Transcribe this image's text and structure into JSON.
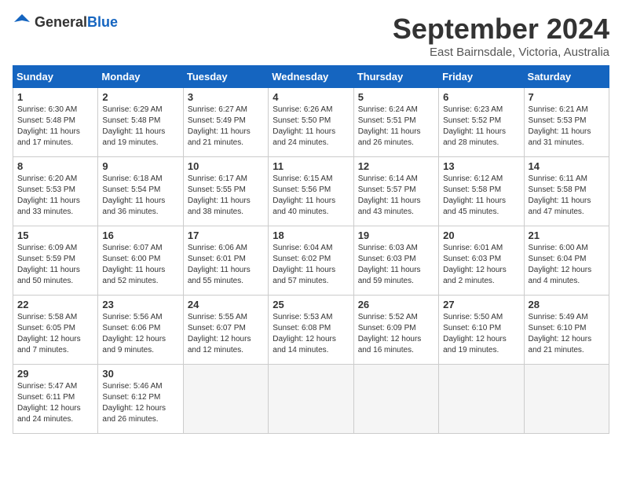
{
  "logo": {
    "general": "General",
    "blue": "Blue"
  },
  "title": "September 2024",
  "location": "East Bairnsdale, Victoria, Australia",
  "days_of_week": [
    "Sunday",
    "Monday",
    "Tuesday",
    "Wednesday",
    "Thursday",
    "Friday",
    "Saturday"
  ],
  "weeks": [
    [
      {
        "day": "1",
        "sunrise": "6:30 AM",
        "sunset": "5:48 PM",
        "daylight": "11 hours and 17 minutes."
      },
      {
        "day": "2",
        "sunrise": "6:29 AM",
        "sunset": "5:48 PM",
        "daylight": "11 hours and 19 minutes."
      },
      {
        "day": "3",
        "sunrise": "6:27 AM",
        "sunset": "5:49 PM",
        "daylight": "11 hours and 21 minutes."
      },
      {
        "day": "4",
        "sunrise": "6:26 AM",
        "sunset": "5:50 PM",
        "daylight": "11 hours and 24 minutes."
      },
      {
        "day": "5",
        "sunrise": "6:24 AM",
        "sunset": "5:51 PM",
        "daylight": "11 hours and 26 minutes."
      },
      {
        "day": "6",
        "sunrise": "6:23 AM",
        "sunset": "5:52 PM",
        "daylight": "11 hours and 28 minutes."
      },
      {
        "day": "7",
        "sunrise": "6:21 AM",
        "sunset": "5:53 PM",
        "daylight": "11 hours and 31 minutes."
      }
    ],
    [
      {
        "day": "8",
        "sunrise": "6:20 AM",
        "sunset": "5:53 PM",
        "daylight": "11 hours and 33 minutes."
      },
      {
        "day": "9",
        "sunrise": "6:18 AM",
        "sunset": "5:54 PM",
        "daylight": "11 hours and 36 minutes."
      },
      {
        "day": "10",
        "sunrise": "6:17 AM",
        "sunset": "5:55 PM",
        "daylight": "11 hours and 38 minutes."
      },
      {
        "day": "11",
        "sunrise": "6:15 AM",
        "sunset": "5:56 PM",
        "daylight": "11 hours and 40 minutes."
      },
      {
        "day": "12",
        "sunrise": "6:14 AM",
        "sunset": "5:57 PM",
        "daylight": "11 hours and 43 minutes."
      },
      {
        "day": "13",
        "sunrise": "6:12 AM",
        "sunset": "5:58 PM",
        "daylight": "11 hours and 45 minutes."
      },
      {
        "day": "14",
        "sunrise": "6:11 AM",
        "sunset": "5:58 PM",
        "daylight": "11 hours and 47 minutes."
      }
    ],
    [
      {
        "day": "15",
        "sunrise": "6:09 AM",
        "sunset": "5:59 PM",
        "daylight": "11 hours and 50 minutes."
      },
      {
        "day": "16",
        "sunrise": "6:07 AM",
        "sunset": "6:00 PM",
        "daylight": "11 hours and 52 minutes."
      },
      {
        "day": "17",
        "sunrise": "6:06 AM",
        "sunset": "6:01 PM",
        "daylight": "11 hours and 55 minutes."
      },
      {
        "day": "18",
        "sunrise": "6:04 AM",
        "sunset": "6:02 PM",
        "daylight": "11 hours and 57 minutes."
      },
      {
        "day": "19",
        "sunrise": "6:03 AM",
        "sunset": "6:03 PM",
        "daylight": "11 hours and 59 minutes."
      },
      {
        "day": "20",
        "sunrise": "6:01 AM",
        "sunset": "6:03 PM",
        "daylight": "12 hours and 2 minutes."
      },
      {
        "day": "21",
        "sunrise": "6:00 AM",
        "sunset": "6:04 PM",
        "daylight": "12 hours and 4 minutes."
      }
    ],
    [
      {
        "day": "22",
        "sunrise": "5:58 AM",
        "sunset": "6:05 PM",
        "daylight": "12 hours and 7 minutes."
      },
      {
        "day": "23",
        "sunrise": "5:56 AM",
        "sunset": "6:06 PM",
        "daylight": "12 hours and 9 minutes."
      },
      {
        "day": "24",
        "sunrise": "5:55 AM",
        "sunset": "6:07 PM",
        "daylight": "12 hours and 12 minutes."
      },
      {
        "day": "25",
        "sunrise": "5:53 AM",
        "sunset": "6:08 PM",
        "daylight": "12 hours and 14 minutes."
      },
      {
        "day": "26",
        "sunrise": "5:52 AM",
        "sunset": "6:09 PM",
        "daylight": "12 hours and 16 minutes."
      },
      {
        "day": "27",
        "sunrise": "5:50 AM",
        "sunset": "6:10 PM",
        "daylight": "12 hours and 19 minutes."
      },
      {
        "day": "28",
        "sunrise": "5:49 AM",
        "sunset": "6:10 PM",
        "daylight": "12 hours and 21 minutes."
      }
    ],
    [
      {
        "day": "29",
        "sunrise": "5:47 AM",
        "sunset": "6:11 PM",
        "daylight": "12 hours and 24 minutes."
      },
      {
        "day": "30",
        "sunrise": "5:46 AM",
        "sunset": "6:12 PM",
        "daylight": "12 hours and 26 minutes."
      },
      null,
      null,
      null,
      null,
      null
    ]
  ]
}
